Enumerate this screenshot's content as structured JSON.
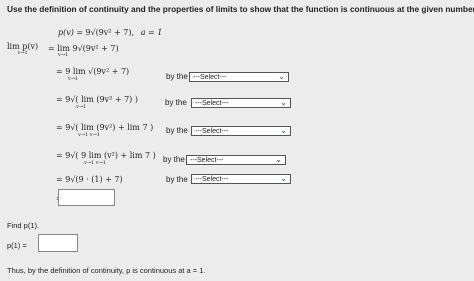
{
  "prompt": "Use the definition of continuity and the properties of limits to show that the function is continuous at the given number a.",
  "function_def": {
    "lhs": "p(v) =",
    "rhs": "9√(9v² + 7),",
    "a_label": "a = 1"
  },
  "steps": [
    {
      "lhs": "lim p(v)",
      "sub": "v→1",
      "rhs": "= lim 9√(9v² + 7)",
      "rhs_sub": "v→1",
      "has_select": false
    },
    {
      "rhs": "= 9 lim √(9v² + 7)",
      "rhs_sub": "v→1",
      "by": "by the",
      "select": "---Select---",
      "has_select": true
    },
    {
      "rhs": "= 9√( lim (9v² + 7) )",
      "rhs_sub": "v→1",
      "by": "by the",
      "select": "---Select---",
      "has_select": true
    },
    {
      "rhs": "= 9√( lim (9v²) + lim 7 )",
      "rhs_sub": "v→1   v→1",
      "by": "by the",
      "select": "---Select---",
      "has_select": true
    },
    {
      "rhs": "= 9√( 9 lim (v²) + lim 7 )",
      "rhs_sub": "v→1   v→1",
      "by": "by the",
      "select": "---Select---",
      "has_select": true
    },
    {
      "rhs": "= 9√(9 · (1) + 7)",
      "by": "by the",
      "select": "---Select---",
      "has_select": true
    },
    {
      "rhs": "=",
      "has_select": false
    }
  ],
  "find_label": "Find p(1).",
  "p1_label": "p(1) =",
  "conclusion": "Thus, by the definition of continuity, p is continuous at a = 1."
}
